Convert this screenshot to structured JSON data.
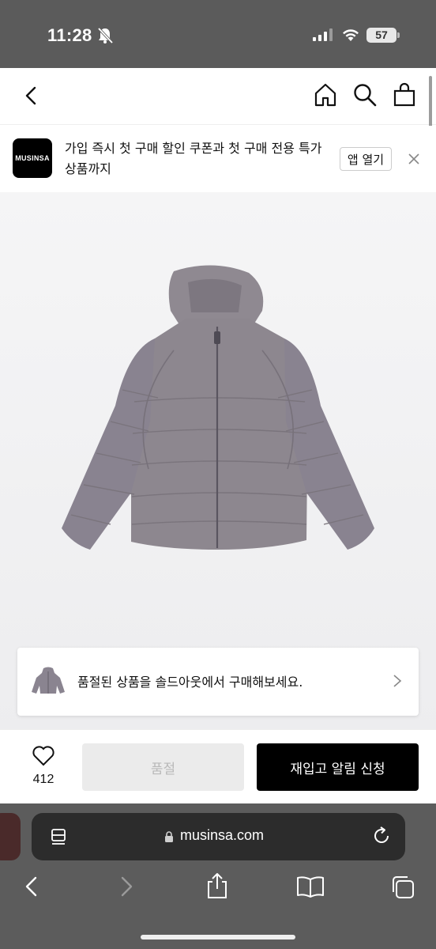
{
  "status_bar": {
    "time": "11:28",
    "battery": "57"
  },
  "nav": {
    "icons": [
      "back-icon",
      "home-icon",
      "search-icon",
      "shopping-bag-icon"
    ]
  },
  "app_banner": {
    "logo_text": "MUSINSA",
    "message": "가입 즉시 첫 구매 할인 쿠폰과 첫 구매 전용 특가 상품까지",
    "open_button": "앱 열기"
  },
  "soldout_card": {
    "text": "품절된 상품을 솔드아웃에서 구매해보세요."
  },
  "bottom_bar": {
    "like_count": "412",
    "soldout_label": "품절",
    "restock_label": "재입고 알림 신청"
  },
  "browser": {
    "url": "musinsa.com"
  },
  "colors": {
    "accent": "#000000",
    "disabled_bg": "#ebebeb",
    "disabled_text": "#b9b9b9",
    "jacket": "#8d878f"
  }
}
